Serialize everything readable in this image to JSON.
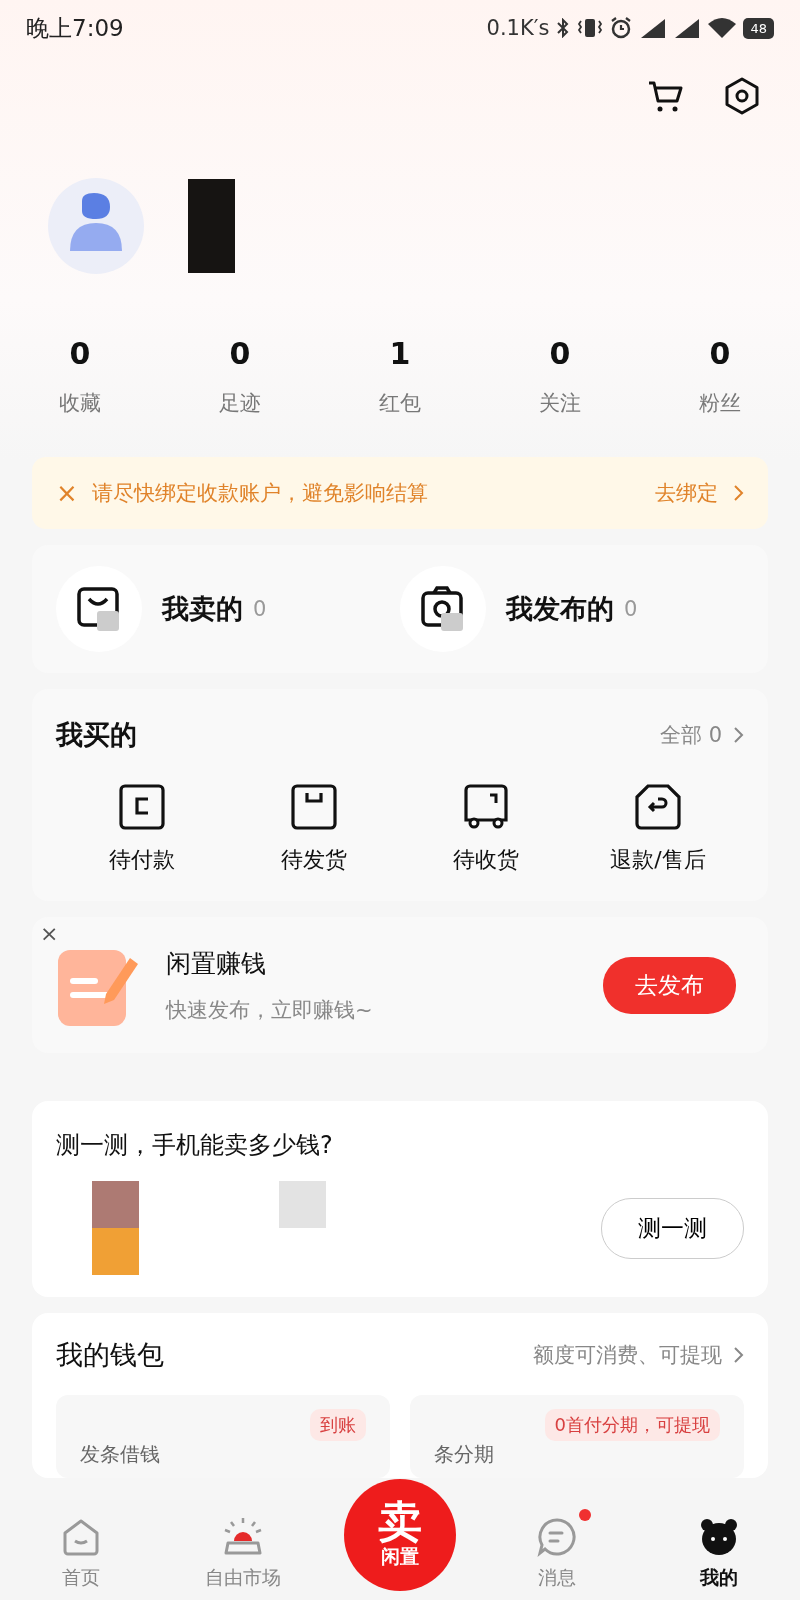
{
  "status_bar": {
    "time": "晚上7:09",
    "speed": "0.1K′s",
    "battery": "48"
  },
  "stats": [
    {
      "value": "0",
      "label": "收藏"
    },
    {
      "value": "0",
      "label": "足迹"
    },
    {
      "value": "1",
      "label": "红包"
    },
    {
      "value": "0",
      "label": "关注"
    },
    {
      "value": "0",
      "label": "粉丝"
    }
  ],
  "notice": {
    "close": "×",
    "text": "请尽快绑定收款账户，避免影响结算",
    "action": "去绑定"
  },
  "selling": [
    {
      "kind": "sold",
      "label": "我卖的",
      "count": "0"
    },
    {
      "kind": "published",
      "label": "我发布的",
      "count": "0"
    }
  ],
  "bought": {
    "title": "我买的",
    "all": "全部 0",
    "items": [
      {
        "kind": "pay",
        "label": "待付款"
      },
      {
        "kind": "ship",
        "label": "待发货"
      },
      {
        "kind": "receive",
        "label": "待收货"
      },
      {
        "kind": "refund",
        "label": "退款/售后"
      }
    ]
  },
  "promo": {
    "close": "×",
    "title": "闲置赚钱",
    "subtitle": "快速发布，立即赚钱~",
    "button": "去发布"
  },
  "estimate": {
    "title": "测一测，手机能卖多少钱?",
    "button": "测一测"
  },
  "wallet": {
    "title": "我的钱包",
    "link": "额度可消费、可提现",
    "cards": [
      {
        "label": "发条借钱",
        "tag": "到账"
      },
      {
        "label": "条分期",
        "tag": "0首付分期，可提现"
      }
    ]
  },
  "nav": [
    {
      "kind": "home",
      "label": "首页",
      "selected": false
    },
    {
      "kind": "market",
      "label": "自由市场",
      "selected": false
    },
    {
      "kind": "sell",
      "label": "卖",
      "sub": "闲置",
      "selected": false
    },
    {
      "kind": "message",
      "label": "消息",
      "selected": false,
      "dot": true
    },
    {
      "kind": "me",
      "label": "我的",
      "selected": true
    }
  ]
}
